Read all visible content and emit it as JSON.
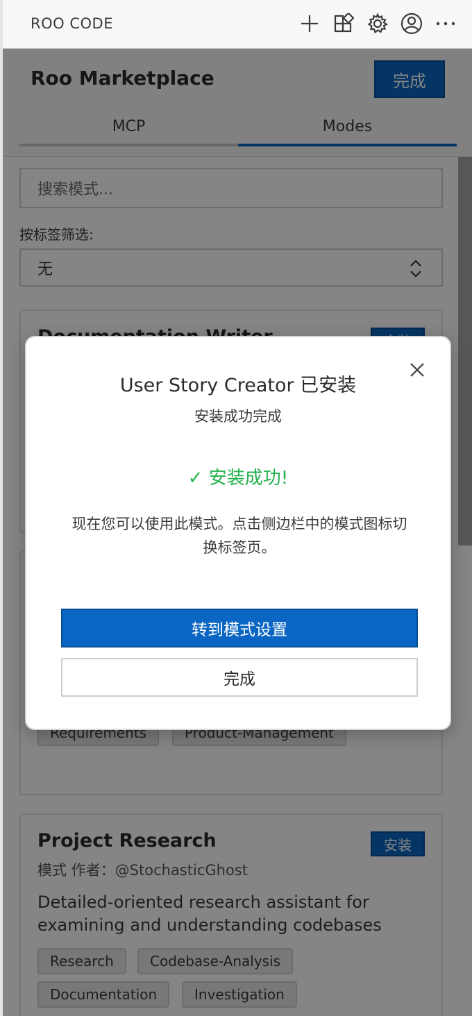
{
  "topbar": {
    "title": "ROO CODE",
    "icons": [
      "plus-icon",
      "marketplace-icon",
      "gear-icon",
      "account-icon",
      "more-icon"
    ]
  },
  "header": {
    "title": "Roo Marketplace",
    "done_label": "完成",
    "tabs": [
      {
        "label": "MCP",
        "active": false
      },
      {
        "label": "Modes",
        "active": true
      }
    ]
  },
  "search": {
    "placeholder": "搜索模式..."
  },
  "filter": {
    "label": "按标签筛选:",
    "selected": "无"
  },
  "cards": [
    {
      "title": "Documentation Writer",
      "install_label": "安装"
    },
    {
      "tags": [
        "Requirements",
        "Product-Management"
      ]
    },
    {
      "title": "Project Research",
      "install_label": "安装",
      "author": "模式 作者：@StochasticGhost",
      "description": "Detailed-oriented research assistant for examining and understanding codebases",
      "tags": [
        "Research",
        "Codebase-Analysis",
        "Documentation",
        "Investigation"
      ]
    }
  ],
  "dialog": {
    "title": "User Story Creator 已安装",
    "subtitle": "安装成功完成",
    "success": "✓ 安装成功!",
    "message": "现在您可以使用此模式。点击侧边栏中的模式图标切换标签页。",
    "primary_label": "转到模式设置",
    "secondary_label": "完成"
  },
  "colors": {
    "accent": "#0a66c2",
    "success": "#22b14c"
  }
}
